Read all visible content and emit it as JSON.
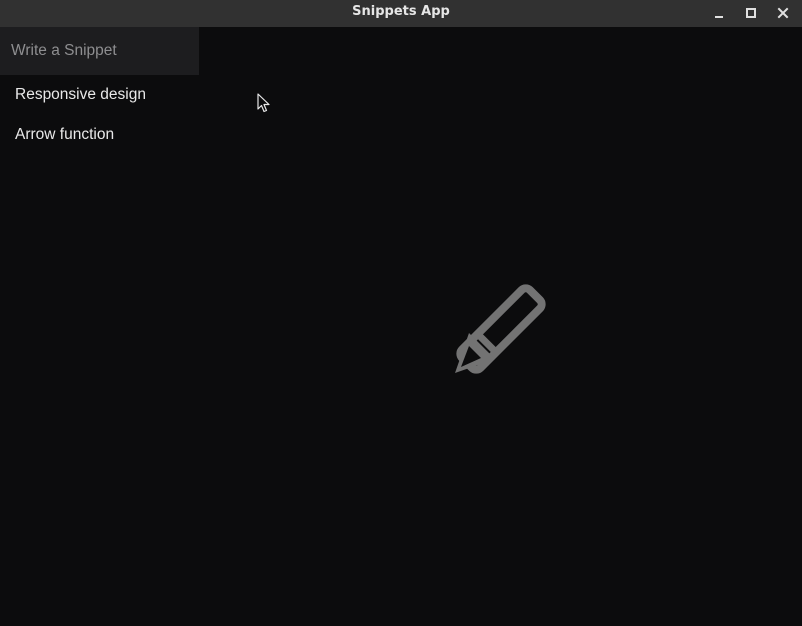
{
  "window": {
    "title": "Snippets App",
    "controls": [
      "minimize-icon",
      "maximize-icon",
      "close-icon"
    ]
  },
  "sidebar": {
    "new_snippet": {
      "placeholder": "Write a Snippet",
      "value": ""
    },
    "items": [
      {
        "label": "Responsive design"
      },
      {
        "label": "Arrow function"
      }
    ]
  },
  "editor": {
    "empty_state_icon": "pencil-icon"
  },
  "colors": {
    "background": "#0c0c0d",
    "titlebar": "#313131",
    "input_background": "#1d1d1f",
    "text": "#e9e9e9",
    "placeholder": "#8e8e90",
    "icon": "#737373"
  }
}
